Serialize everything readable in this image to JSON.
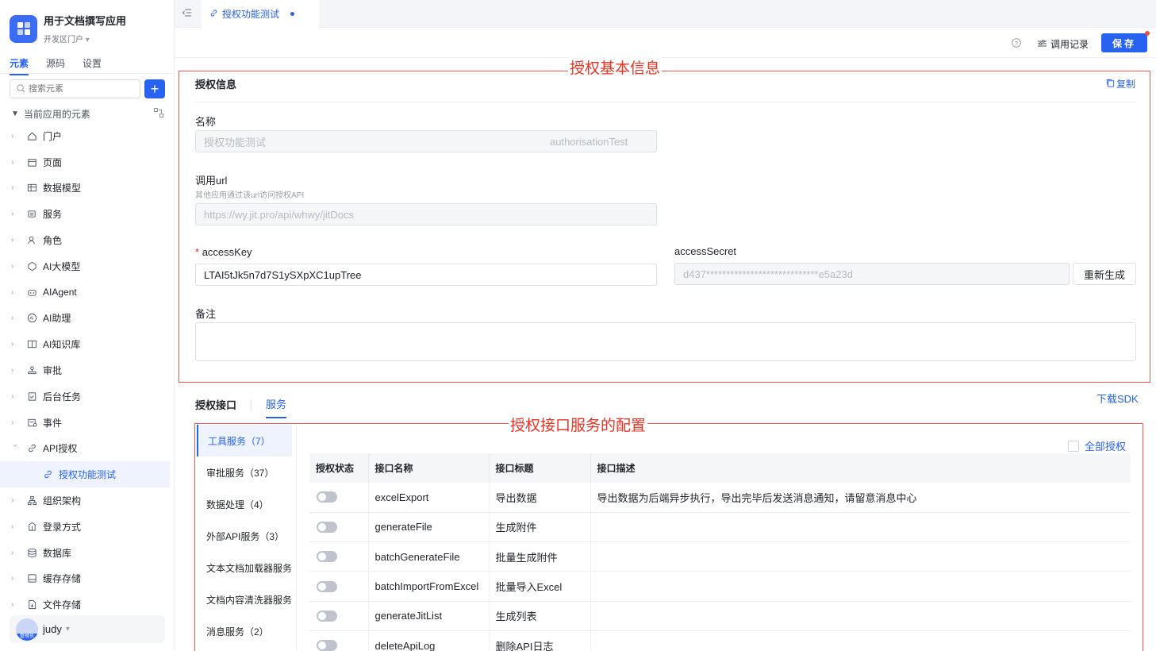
{
  "app": {
    "name": "用于文档撰写应用",
    "portal": "开发区门户"
  },
  "sidebar": {
    "tabs": [
      {
        "label": "元素"
      },
      {
        "label": "源码"
      },
      {
        "label": "设置"
      }
    ],
    "search_placeholder": "搜索元素",
    "section_label": "当前应用的元素",
    "items": [
      {
        "label": "门户",
        "icon": "home-icon"
      },
      {
        "label": "页面",
        "icon": "page-icon"
      },
      {
        "label": "数据模型",
        "icon": "table-icon"
      },
      {
        "label": "服务",
        "icon": "service-icon"
      },
      {
        "label": "角色",
        "icon": "role-icon"
      },
      {
        "label": "AI大模型",
        "icon": "ai-model-icon"
      },
      {
        "label": "AIAgent",
        "icon": "robot-icon"
      },
      {
        "label": "AI助理",
        "icon": "ai-assistant-icon"
      },
      {
        "label": "AI知识库",
        "icon": "book-icon"
      },
      {
        "label": "审批",
        "icon": "stamp-icon"
      },
      {
        "label": "后台任务",
        "icon": "task-icon"
      },
      {
        "label": "事件",
        "icon": "event-icon"
      },
      {
        "label": "API授权",
        "icon": "link-icon"
      }
    ],
    "child_item": {
      "label": "授权功能测试",
      "icon": "link-icon"
    },
    "items_after": [
      {
        "label": "组织架构",
        "icon": "org-icon"
      },
      {
        "label": "登录方式",
        "icon": "login-icon"
      },
      {
        "label": "数据库",
        "icon": "database-icon"
      },
      {
        "label": "缓存存储",
        "icon": "cache-icon"
      },
      {
        "label": "文件存储",
        "icon": "file-icon"
      }
    ],
    "user": {
      "name": "judy",
      "badge": "管理员"
    }
  },
  "tabbar": {
    "active_tab": "授权功能测试"
  },
  "toolbar": {
    "call_log": "调用记录",
    "save": "保存"
  },
  "annotations": {
    "basic": "授权基本信息",
    "service": "授权接口服务的配置"
  },
  "form": {
    "section_title": "授权信息",
    "copy": "复制",
    "name_label": "名称",
    "name_value": "授权功能测试",
    "name_key": "authorisationTest",
    "url_label": "调用url",
    "url_hint": "其他应用通过该url访问授权API",
    "url_value": "https://wy.jit.pro/api/whwy/jitDocs",
    "access_key_required": "*",
    "access_key_label": "accessKey",
    "access_key_value": "LTAI5tJk5n7d7S1ySXpXC1upTree",
    "access_secret_label": "accessSecret",
    "access_secret_value": "d437****************************e5a23d",
    "regen": "重新生成",
    "remark_label": "备注"
  },
  "auth": {
    "tab_label": "授权接口",
    "service_tab": "服务",
    "sdk": "下载SDK",
    "all_auth": "全部授权",
    "services": [
      {
        "label": "工具服务（7）"
      },
      {
        "label": "审批服务（37）"
      },
      {
        "label": "数据处理（4）"
      },
      {
        "label": "外部API服务（3）"
      },
      {
        "label": "文本文档加载器服务"
      },
      {
        "label": "文档内容清洗器服务"
      },
      {
        "label": "消息服务（2）"
      }
    ],
    "columns": [
      "授权状态",
      "接口名称",
      "接口标题",
      "接口描述"
    ],
    "rows": [
      {
        "name": "excelExport",
        "title": "导出数据",
        "desc": "导出数据为后端异步执行，导出完毕后发送消息通知，请留意消息中心",
        "enabled": false
      },
      {
        "name": "generateFile",
        "title": "生成附件",
        "desc": "",
        "enabled": false
      },
      {
        "name": "batchGenerateFile",
        "title": "批量生成附件",
        "desc": "",
        "enabled": false
      },
      {
        "name": "batchImportFromExcel",
        "title": "批量导入Excel",
        "desc": "",
        "enabled": false
      },
      {
        "name": "generateJitList",
        "title": "生成列表",
        "desc": "",
        "enabled": false
      },
      {
        "name": "deleteApiLog",
        "title": "删除API日志",
        "desc": "",
        "enabled": false
      }
    ]
  }
}
